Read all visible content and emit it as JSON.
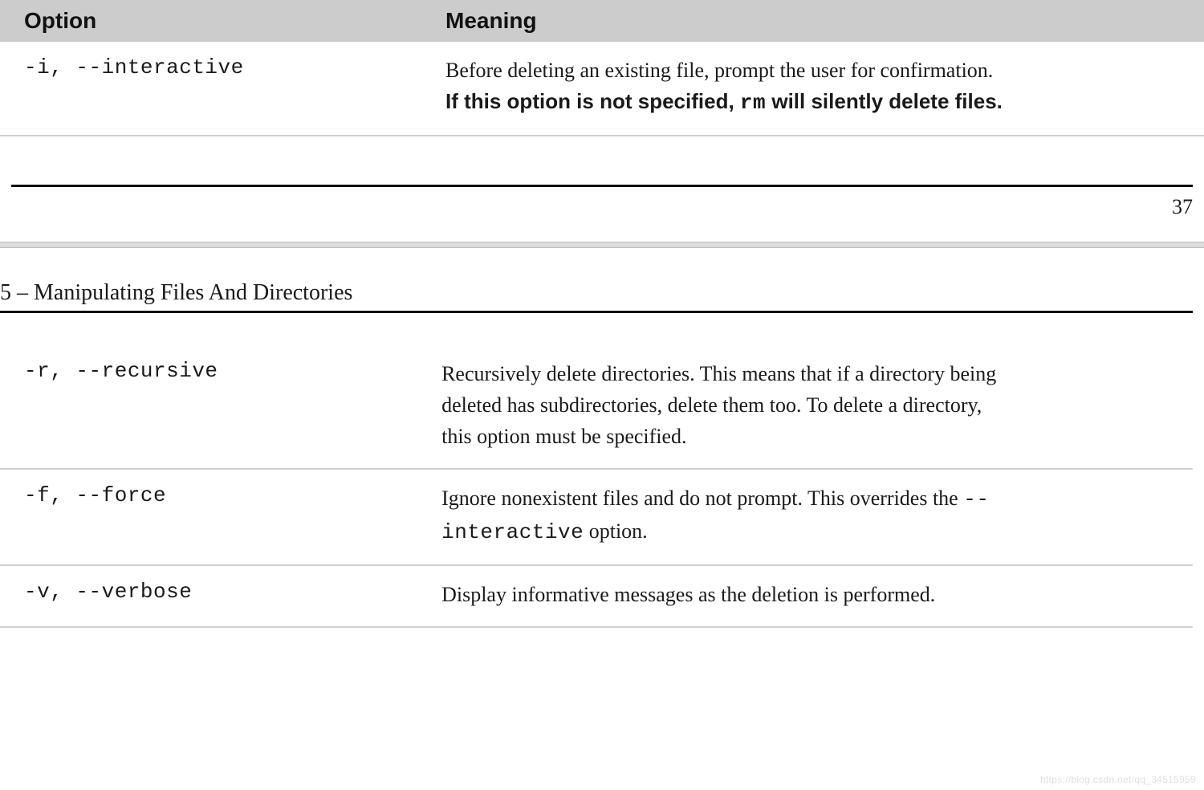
{
  "table": {
    "headers": {
      "option": "Option",
      "meaning": "Meaning"
    }
  },
  "rows_top": [
    {
      "option": "-i, --interactive",
      "meaning_pre": "Before deleting an existing file, prompt the user for confirmation.  ",
      "meaning_bold_pre": "If this option is not specified, ",
      "meaning_bold_code": "rm",
      "meaning_bold_post": " will silently delete files."
    }
  ],
  "page_number": "37",
  "chapter_title": "5 – Manipulating Files And Directories",
  "rows_bottom": [
    {
      "option": "-r, --recursive",
      "meaning": "Recursively delete directories.  This means that if a directory being deleted has subdirectories, delete them too.  To delete a directory, this option must be specified."
    },
    {
      "option": "-f, --force",
      "meaning_pre": "Ignore nonexistent files and do not prompt.  This overrides the ",
      "meaning_code": "--interactive",
      "meaning_post": " option."
    },
    {
      "option": "-v, --verbose",
      "meaning": "Display informative messages as the deletion is performed."
    }
  ],
  "watermark": "https://blog.csdn.net/qq_34515959"
}
